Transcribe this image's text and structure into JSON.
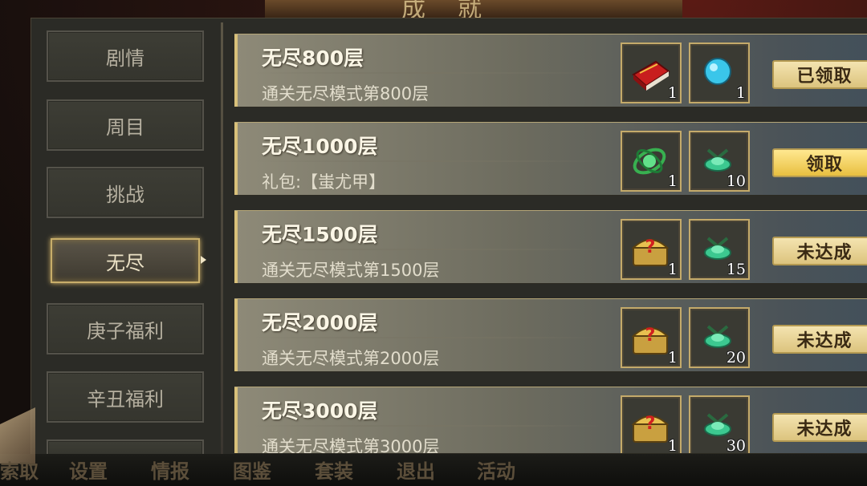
{
  "banner": {
    "title": "成就"
  },
  "sidebar": {
    "items": [
      {
        "label": "剧情"
      },
      {
        "label": "周目"
      },
      {
        "label": "挑战"
      },
      {
        "label": "无尽"
      },
      {
        "label": "庚子福利"
      },
      {
        "label": "辛丑福利"
      }
    ],
    "active": "无尽"
  },
  "rows": [
    {
      "title": "无尽800层",
      "desc": "通关无尽模式第800层",
      "rewards": [
        {
          "icon": "red-book-icon",
          "count": "1"
        },
        {
          "icon": "blue-orb-icon",
          "count": "1"
        }
      ],
      "button": "已领取"
    },
    {
      "title": "无尽1000层",
      "desc": "礼包:【蚩尤甲】",
      "rewards": [
        {
          "icon": "green-swirl-orb-icon",
          "count": "1"
        },
        {
          "icon": "jade-ingot-icon",
          "count": "10"
        }
      ],
      "button": "领取"
    },
    {
      "title": "无尽1500层",
      "desc": "通关无尽模式第1500层",
      "rewards": [
        {
          "icon": "mystery-chest-icon",
          "count": "1"
        },
        {
          "icon": "jade-ingot-icon",
          "count": "15"
        }
      ],
      "button": "未达成"
    },
    {
      "title": "无尽2000层",
      "desc": "通关无尽模式第2000层",
      "rewards": [
        {
          "icon": "mystery-chest-icon",
          "count": "1"
        },
        {
          "icon": "jade-ingot-icon",
          "count": "20"
        }
      ],
      "button": "未达成"
    },
    {
      "title": "无尽3000层",
      "desc": "通关无尽模式第3000层",
      "rewards": [
        {
          "icon": "mystery-chest-icon",
          "count": "1"
        },
        {
          "icon": "jade-ingot-icon",
          "count": "30"
        }
      ],
      "button": "未达成"
    }
  ],
  "bottom_menu": [
    "索取",
    "设置",
    "情报",
    "图鉴",
    "套装",
    "退出",
    "活动"
  ],
  "colors": {
    "accent_gold": "#c8ae6a",
    "button_gold": "#e8bf40",
    "row_bg": "#6c6b5e"
  }
}
